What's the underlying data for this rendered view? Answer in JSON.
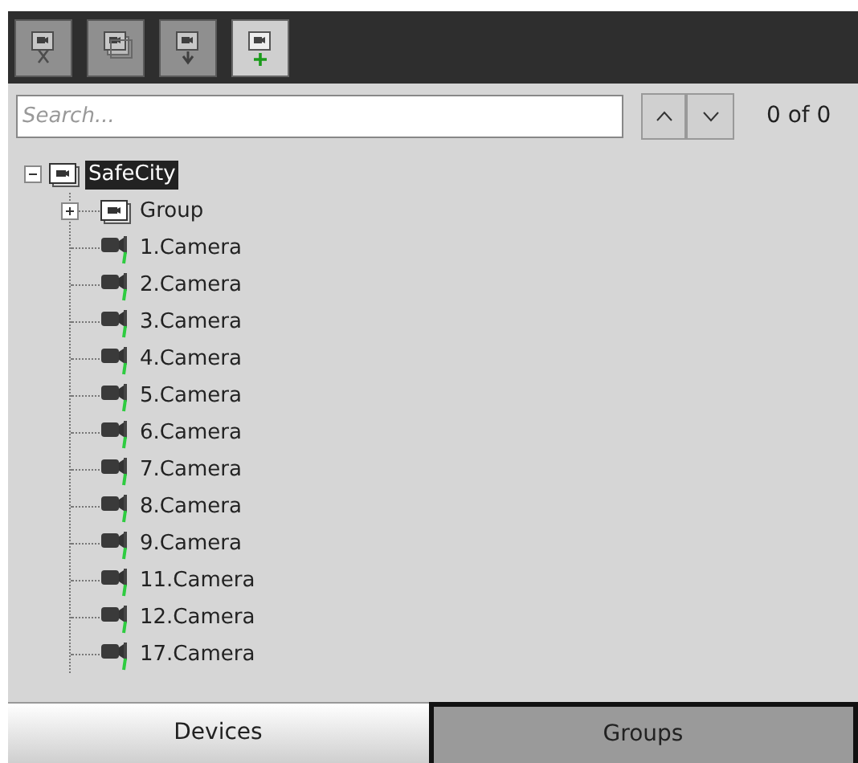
{
  "toolbar": {
    "buttons": [
      {
        "kind": "cut",
        "disabled": true
      },
      {
        "kind": "copy",
        "disabled": true
      },
      {
        "kind": "move",
        "disabled": true
      },
      {
        "kind": "add",
        "disabled": false
      }
    ]
  },
  "search": {
    "placeholder": "Search...",
    "result": "0 of 0"
  },
  "tree": [
    {
      "label": "SafeCity",
      "kind": "group",
      "expanded": true,
      "selected": true,
      "children": [
        {
          "label": "Group",
          "kind": "group",
          "expanded": false,
          "selected": false,
          "has_children": true
        },
        {
          "label": "1.Camera",
          "kind": "camera",
          "selected": false
        },
        {
          "label": "2.Camera",
          "kind": "camera",
          "selected": false
        },
        {
          "label": "3.Camera",
          "kind": "camera",
          "selected": false
        },
        {
          "label": "4.Camera",
          "kind": "camera",
          "selected": false
        },
        {
          "label": "5.Camera",
          "kind": "camera",
          "selected": false
        },
        {
          "label": "6.Camera",
          "kind": "camera",
          "selected": false
        },
        {
          "label": "7.Camera",
          "kind": "camera",
          "selected": false
        },
        {
          "label": "8.Camera",
          "kind": "camera",
          "selected": false
        },
        {
          "label": "9.Camera",
          "kind": "camera",
          "selected": false
        },
        {
          "label": "11.Camera",
          "kind": "camera",
          "selected": false
        },
        {
          "label": "12.Camera",
          "kind": "camera",
          "selected": false
        },
        {
          "label": "17.Camera",
          "kind": "camera",
          "selected": false
        }
      ]
    }
  ],
  "tabs": [
    {
      "label": "Devices",
      "selected": false
    },
    {
      "label": "Groups",
      "selected": true
    }
  ]
}
